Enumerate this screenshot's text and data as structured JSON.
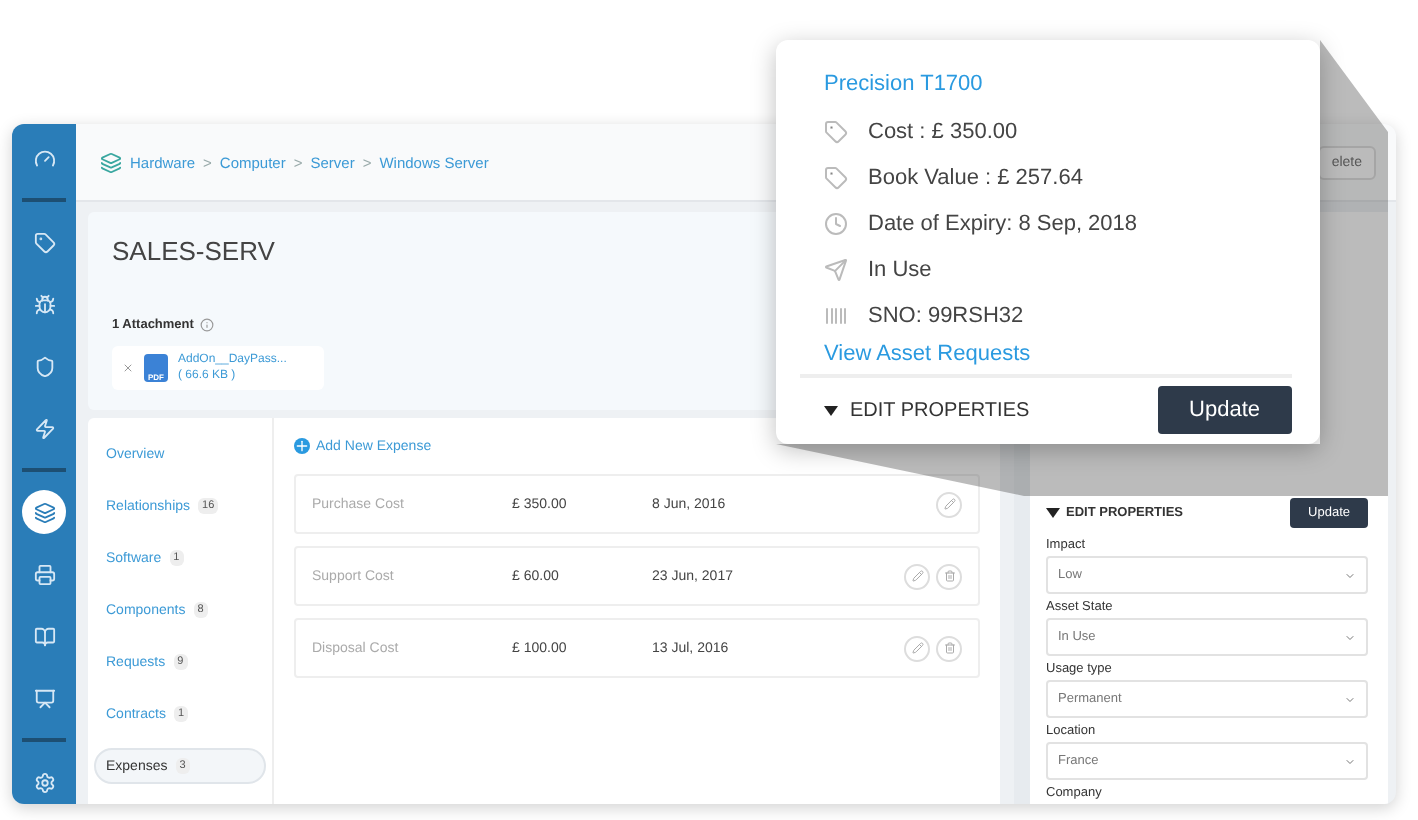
{
  "sidebar": {
    "items": [
      {
        "kind": "gauge",
        "selected": false
      },
      {
        "kind": "divider"
      },
      {
        "kind": "ticket",
        "selected": false
      },
      {
        "kind": "bug",
        "selected": false
      },
      {
        "kind": "shield",
        "selected": false
      },
      {
        "kind": "bolt",
        "selected": false
      },
      {
        "kind": "divider"
      },
      {
        "kind": "stack",
        "selected": true
      },
      {
        "kind": "printer",
        "selected": false
      },
      {
        "kind": "book",
        "selected": false
      },
      {
        "kind": "board",
        "selected": false
      },
      {
        "kind": "divider"
      },
      {
        "kind": "gear",
        "selected": false
      }
    ]
  },
  "breadcrumb": {
    "separator": ">",
    "items": [
      "Hardware",
      "Computer",
      "Server",
      "Windows Server"
    ]
  },
  "header_button": "elete",
  "asset": {
    "name": "SALES-SERV",
    "attachments_label": "1 Attachment",
    "attachment": {
      "name": "AddOn__DayPass...",
      "size": "( 66.6 KB )",
      "type": "PDF"
    }
  },
  "nav": [
    {
      "label": "Overview",
      "selected": false
    },
    {
      "label": "Relationships",
      "count": "16",
      "selected": false
    },
    {
      "label": "Software",
      "count": "1",
      "selected": false
    },
    {
      "label": "Components",
      "count": "8",
      "selected": false
    },
    {
      "label": "Requests",
      "count": "9",
      "selected": false
    },
    {
      "label": "Contracts",
      "count": "1",
      "selected": false
    },
    {
      "label": "Expenses",
      "count": "3",
      "selected": true
    }
  ],
  "expenses": {
    "add_label": "Add New Expense",
    "rows": [
      {
        "name": "Purchase Cost",
        "amount": "£ 350.00",
        "date": "8 Jun, 2016",
        "deletable": false
      },
      {
        "name": "Support Cost",
        "amount": "£ 60.00",
        "date": "23 Jun, 2017",
        "deletable": true
      },
      {
        "name": "Disposal Cost",
        "amount": "£ 100.00",
        "date": "13 Jul, 2016",
        "deletable": true
      }
    ]
  },
  "properties": {
    "header": "EDIT PROPERTIES",
    "button": "Update",
    "fields": [
      {
        "label": "Impact",
        "value": "Low"
      },
      {
        "label": "Asset State",
        "value": "In Use"
      },
      {
        "label": "Usage type",
        "value": "Permanent"
      },
      {
        "label": "Location",
        "value": "France"
      }
    ],
    "last_label": "Company"
  },
  "popup": {
    "title": "Precision T1700",
    "details": [
      {
        "kind": "price",
        "text": "Cost : £ 350.00"
      },
      {
        "kind": "price",
        "text": "Book Value : £ 257.64"
      },
      {
        "kind": "clock",
        "text": "Date of Expiry: 8 Sep, 2018"
      },
      {
        "kind": "status",
        "text": "In Use"
      },
      {
        "kind": "barcode",
        "text": "SNO: 99RSH32"
      }
    ],
    "link": "View Asset Requests",
    "edit_header": "EDIT PROPERTIES",
    "button": "Update"
  }
}
